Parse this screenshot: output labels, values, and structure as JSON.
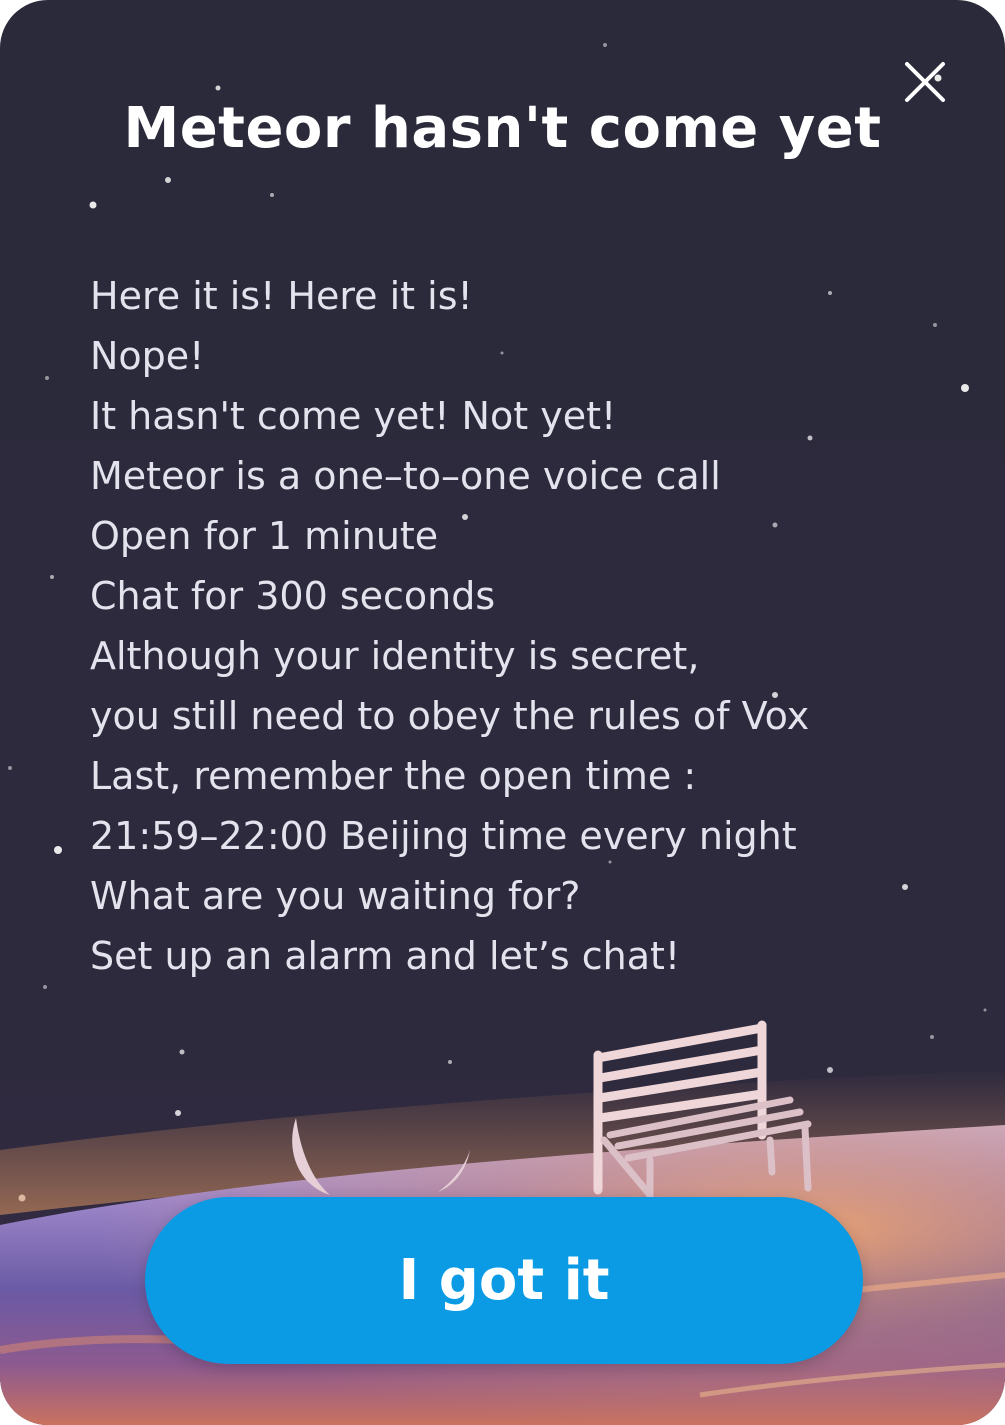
{
  "dialog": {
    "title": "Meteor hasn't come yet",
    "close_icon": "close-icon",
    "lines": [
      "Here it is! Here it is!",
      "Nope!",
      "It hasn't come yet! Not yet!",
      "Meteor is a one–to–one voice call",
      "Open for 1 minute",
      "Chat for 300 seconds",
      "Although your identity is secret,",
      "you still need to obey the rules of Vox",
      "Last, remember the open time :",
      "21:59–22:00 Beijing time every night",
      "What are you waiting for?",
      "Set up an alarm and let’s chat!"
    ],
    "button_label": "I got it"
  },
  "colors": {
    "background": "#2a2a3a",
    "accent": "#0a9be4",
    "title_text": "#ffffff",
    "body_text": "#e3e3ee"
  }
}
